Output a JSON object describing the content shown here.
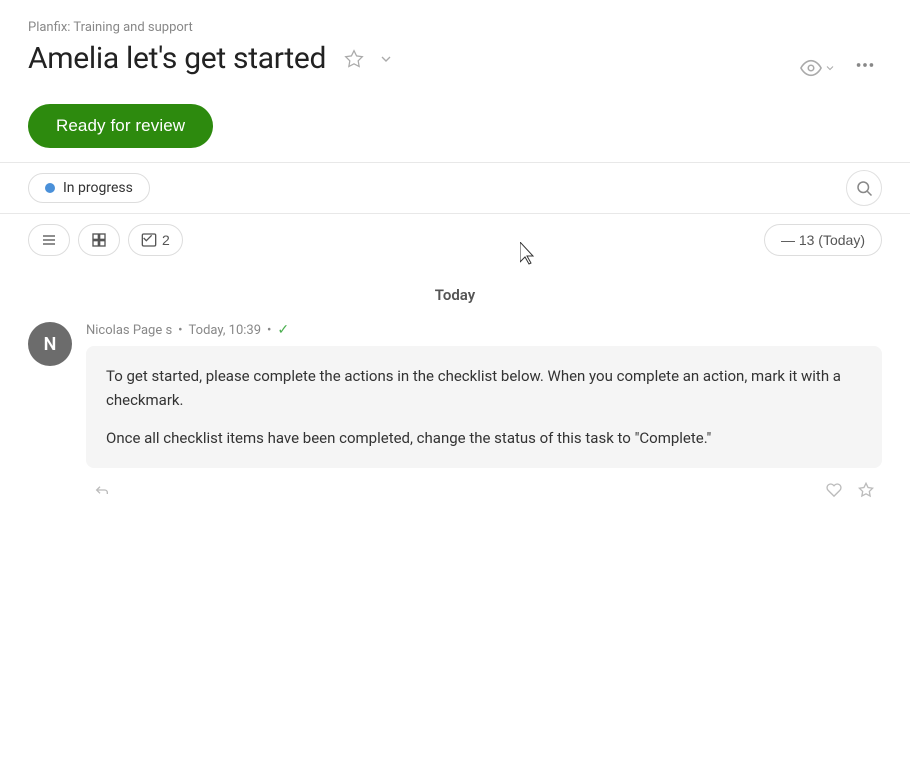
{
  "breadcrumb": {
    "text": "Planfix: Training and support"
  },
  "header": {
    "title": "Amelia let's get started",
    "star_label": "★",
    "dropdown_label": "▾"
  },
  "header_actions": {
    "eye_label": "👁",
    "more_label": "•••"
  },
  "status_button": {
    "label": "Ready for review"
  },
  "status_bar": {
    "status_text": "In progress",
    "search_label": "🔍"
  },
  "toolbar": {
    "list_icon": "list",
    "table_icon": "table",
    "checklist_label": "2",
    "date_badge": "— 13 (Today)"
  },
  "today": {
    "label": "Today"
  },
  "message": {
    "author": "Nicolas Page s",
    "separator": "•",
    "time": "Today, 10:39",
    "check": "✓",
    "avatar_letter": "N",
    "body_line1": "To get started, please complete the actions in the checklist below. When you complete an action, mark it with a checkmark.",
    "body_line2": "Once all checklist items have been completed, change the status of this task to \"Complete.\""
  }
}
